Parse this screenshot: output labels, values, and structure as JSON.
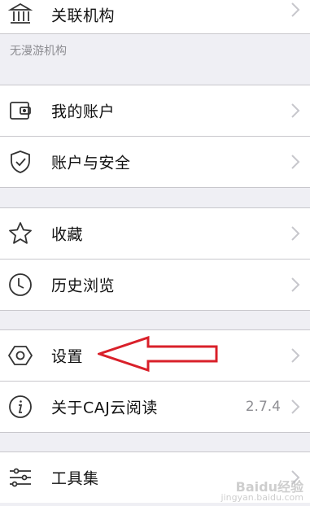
{
  "menu": {
    "related_institution": "关联机构",
    "section_label": "无漫游机构",
    "my_account": "我的账户",
    "account_security": "账户与安全",
    "favorites": "收藏",
    "history": "历史浏览",
    "settings": "设置",
    "about": "关于CAJ云阅读",
    "about_version": "2.7.4",
    "toolset": "工具集"
  },
  "icons": {
    "related_institution": "bank-icon",
    "my_account": "wallet-icon",
    "account_security": "shield-check-icon",
    "favorites": "star-icon",
    "history": "clock-icon",
    "settings": "hexagon-gear-icon",
    "about": "info-icon",
    "toolset": "sliders-icon",
    "chevron": "chevron-right-icon"
  },
  "watermark": {
    "brand": "Baidu经验",
    "url": "jingyan.baidu.com"
  },
  "colors": {
    "background": "#efeff4",
    "row": "#ffffff",
    "separator": "#c8c7cc",
    "annotation_arrow": "#d9202a",
    "icon_stroke": "#333333",
    "chevron": "#c7c7cc"
  }
}
